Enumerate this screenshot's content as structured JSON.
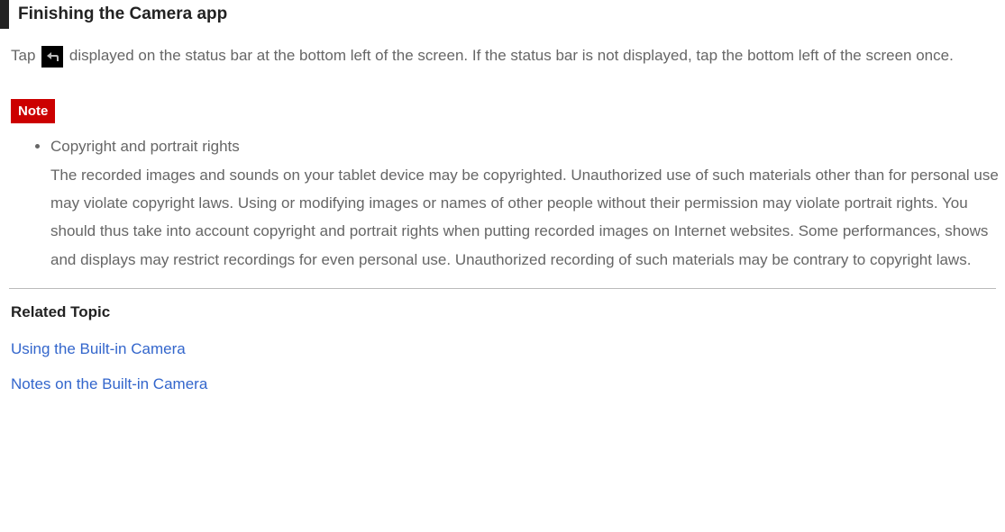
{
  "heading": "Finishing the Camera app",
  "para_before": "Tap ",
  "para_after": " displayed on the status bar at the bottom left of the screen. If the status bar is not displayed, tap the bottom left of the screen once.",
  "note_label": "Note",
  "note_items": [
    {
      "title": "Copyright and portrait rights",
      "body": "The recorded images and sounds on your tablet device may be copyrighted. Unauthorized use of such materials other than for personal use may violate copyright laws. Using or modifying images or names of other people without their permission may violate portrait rights. You should thus take into account copyright and portrait rights when putting recorded images on Internet websites. Some performances, shows and displays may restrict recordings for even personal use. Unauthorized recording of such materials may be contrary to copyright laws."
    }
  ],
  "related_heading": "Related Topic",
  "related_links": [
    "Using the Built-in Camera",
    "Notes on the Built-in Camera"
  ]
}
